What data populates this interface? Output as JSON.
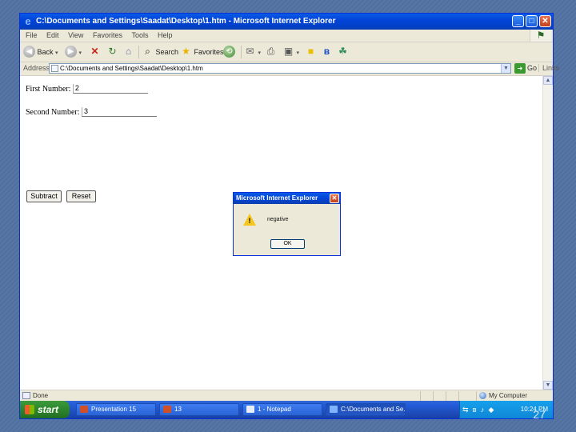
{
  "window": {
    "title": "C:\\Documents and Settings\\Saadat\\Desktop\\1.htm - Microsoft Internet Explorer",
    "controls": {
      "minimize": "_",
      "maximize": "□",
      "close": "✕"
    }
  },
  "menubar": {
    "items": [
      "File",
      "Edit",
      "View",
      "Favorites",
      "Tools",
      "Help"
    ]
  },
  "toolbar": {
    "back_label": "Back",
    "search_label": "Search",
    "favorites_label": "Favorites"
  },
  "addressbar": {
    "label": "Address",
    "value": "C:\\Documents and Settings\\Saadat\\Desktop\\1.htm",
    "go_label": "Go",
    "links_label": "Links"
  },
  "form": {
    "first_label": "First Number:",
    "first_value": "2",
    "second_label": "Second Number:",
    "second_value": "3",
    "subtract_label": "Subtract",
    "reset_label": "Reset"
  },
  "dialog": {
    "title": "Microsoft Internet Explorer",
    "message": "negative",
    "ok_label": "OK"
  },
  "statusbar": {
    "status_text": "Done",
    "zone_text": "My Computer"
  },
  "taskbar": {
    "start_label": "start",
    "tasks": [
      {
        "label": "Presentation 15"
      },
      {
        "label": "13"
      },
      {
        "label": "1 - Notepad"
      },
      {
        "label": "C:\\Documents and Se..."
      }
    ],
    "clock": "10:24 PM"
  },
  "slide_number": "27",
  "colors": {
    "title_blue": "#0a5be6",
    "start_green": "#3c9a3c",
    "slide_background": "#4f6fa0",
    "warning_yellow": "#f5c71a"
  },
  "icons": [
    "ie-logo-icon",
    "back-icon",
    "forward-icon",
    "stop-icon",
    "refresh-icon",
    "home-icon",
    "search-icon",
    "favorites-icon",
    "history-icon",
    "mail-icon",
    "print-icon",
    "edit-icon",
    "messenger-icon",
    "warning-icon",
    "globe-icon"
  ]
}
